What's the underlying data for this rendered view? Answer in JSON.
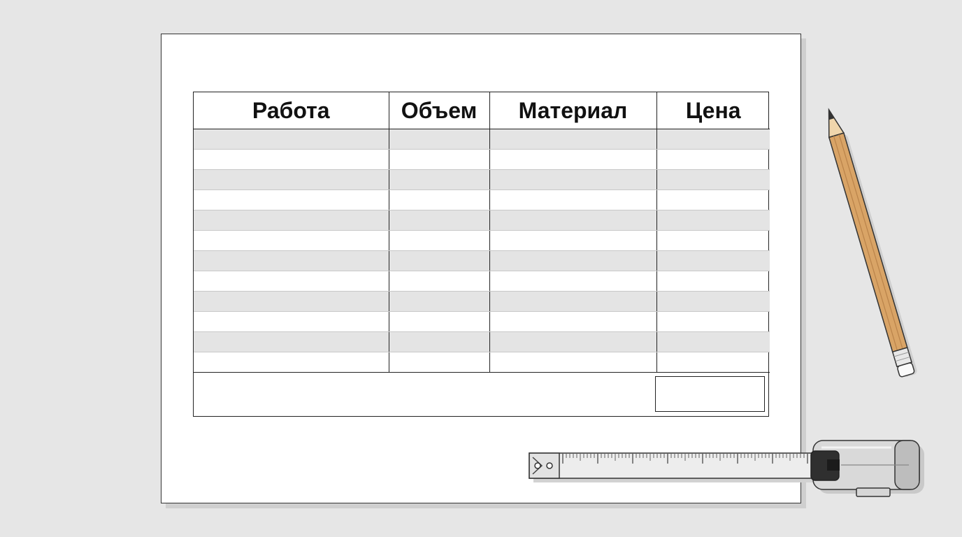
{
  "estimate_table": {
    "headers": [
      "Работа",
      "Объем",
      "Материал",
      "Цена"
    ],
    "row_count": 12,
    "total_value": ""
  },
  "props": {
    "pencil_icon": "pencil-icon",
    "tape_measure_icon": "tape-measure-icon"
  },
  "colors": {
    "background": "#e6e6e6",
    "paper": "#ffffff",
    "row_shade": "#e4e4e4",
    "pencil_wood": "#d9a466"
  }
}
